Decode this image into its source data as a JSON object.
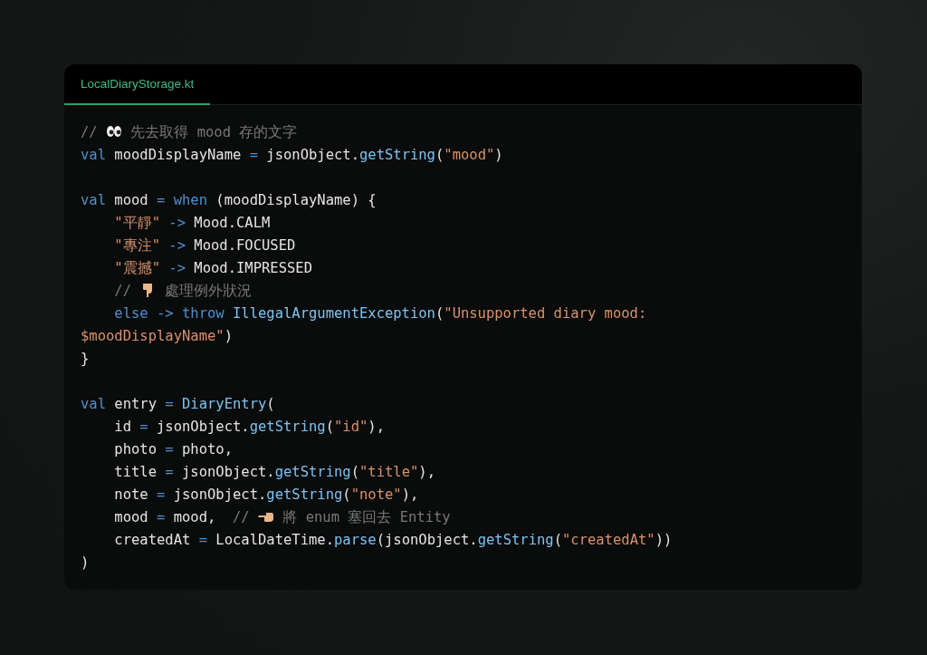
{
  "tab": {
    "label": "LocalDiaryStorage.kt",
    "selected": true
  },
  "lines": [
    {
      "kind": "code",
      "tokens": [
        {
          "kind": "comment",
          "t": "// "
        },
        {
          "kind": "eyes"
        },
        {
          "kind": "comment",
          "t": " 先去取得 mood 存的文字"
        }
      ]
    },
    {
      "kind": "code",
      "tokens": [
        {
          "kind": "keyword",
          "t": "val"
        },
        {
          "kind": "plain",
          "t": " moodDisplayName "
        },
        {
          "kind": "keyword",
          "t": "="
        },
        {
          "kind": "plain",
          "t": " jsonObject."
        },
        {
          "kind": "function",
          "t": "getString"
        },
        {
          "kind": "plain",
          "t": "("
        },
        {
          "kind": "string",
          "t": "\"mood\""
        },
        {
          "kind": "plain",
          "t": ")"
        }
      ]
    },
    {
      "kind": "blank"
    },
    {
      "kind": "code",
      "tokens": [
        {
          "kind": "keyword",
          "t": "val"
        },
        {
          "kind": "plain",
          "t": " mood "
        },
        {
          "kind": "keyword",
          "t": "="
        },
        {
          "kind": "keyword",
          "t": " when"
        },
        {
          "kind": "plain",
          "t": " (moodDisplayName) {"
        }
      ]
    },
    {
      "kind": "code",
      "tokens": [
        {
          "kind": "string",
          "t": "    \"平靜\""
        },
        {
          "kind": "keyword",
          "t": " ->"
        },
        {
          "kind": "plain",
          "t": " Mood.CALM"
        }
      ]
    },
    {
      "kind": "code",
      "tokens": [
        {
          "kind": "string",
          "t": "    \"專注\""
        },
        {
          "kind": "keyword",
          "t": " ->"
        },
        {
          "kind": "plain",
          "t": " Mood.FOCUSED"
        }
      ]
    },
    {
      "kind": "code",
      "tokens": [
        {
          "kind": "string",
          "t": "    \"震撼\""
        },
        {
          "kind": "keyword",
          "t": " ->"
        },
        {
          "kind": "plain",
          "t": " Mood.IMPRESSED"
        }
      ]
    },
    {
      "kind": "code",
      "tokens": [
        {
          "kind": "comment",
          "t": "    // "
        },
        {
          "kind": "hand-down"
        },
        {
          "kind": "comment",
          "t": " 處理例外狀況"
        }
      ]
    },
    {
      "kind": "code",
      "tokens": [
        {
          "kind": "keyword",
          "t": "    else ->"
        },
        {
          "kind": "keyword",
          "t": " throw"
        },
        {
          "kind": "function",
          "t": " IllegalArgumentException"
        },
        {
          "kind": "plain",
          "t": "("
        },
        {
          "kind": "string",
          "t": "\"Unsupported diary mood:"
        }
      ]
    },
    {
      "kind": "code",
      "tokens": [
        {
          "kind": "string",
          "t": "$moodDisplayName\""
        },
        {
          "kind": "plain",
          "t": ")"
        }
      ]
    },
    {
      "kind": "code",
      "tokens": [
        {
          "kind": "plain",
          "t": "}"
        }
      ]
    },
    {
      "kind": "blank"
    },
    {
      "kind": "code",
      "tokens": [
        {
          "kind": "keyword",
          "t": "val"
        },
        {
          "kind": "plain",
          "t": " entry "
        },
        {
          "kind": "keyword",
          "t": "="
        },
        {
          "kind": "function",
          "t": " DiaryEntry"
        },
        {
          "kind": "plain",
          "t": "("
        }
      ]
    },
    {
      "kind": "code",
      "tokens": [
        {
          "kind": "plain",
          "t": "    id "
        },
        {
          "kind": "keyword",
          "t": "="
        },
        {
          "kind": "plain",
          "t": " jsonObject."
        },
        {
          "kind": "function",
          "t": "getString"
        },
        {
          "kind": "plain",
          "t": "("
        },
        {
          "kind": "string",
          "t": "\"id\""
        },
        {
          "kind": "plain",
          "t": "),"
        }
      ]
    },
    {
      "kind": "code",
      "tokens": [
        {
          "kind": "plain",
          "t": "    photo "
        },
        {
          "kind": "keyword",
          "t": "="
        },
        {
          "kind": "plain",
          "t": " photo,"
        }
      ]
    },
    {
      "kind": "code",
      "tokens": [
        {
          "kind": "plain",
          "t": "    title "
        },
        {
          "kind": "keyword",
          "t": "="
        },
        {
          "kind": "plain",
          "t": " jsonObject."
        },
        {
          "kind": "function",
          "t": "getString"
        },
        {
          "kind": "plain",
          "t": "("
        },
        {
          "kind": "string",
          "t": "\"title\""
        },
        {
          "kind": "plain",
          "t": "),"
        }
      ]
    },
    {
      "kind": "code",
      "tokens": [
        {
          "kind": "plain",
          "t": "    note "
        },
        {
          "kind": "keyword",
          "t": "="
        },
        {
          "kind": "plain",
          "t": " jsonObject."
        },
        {
          "kind": "function",
          "t": "getString"
        },
        {
          "kind": "plain",
          "t": "("
        },
        {
          "kind": "string",
          "t": "\"note\""
        },
        {
          "kind": "plain",
          "t": "),"
        }
      ]
    },
    {
      "kind": "code",
      "tokens": [
        {
          "kind": "plain",
          "t": "    mood "
        },
        {
          "kind": "keyword",
          "t": "="
        },
        {
          "kind": "plain",
          "t": " mood,"
        },
        {
          "kind": "comment",
          "t": "  // "
        },
        {
          "kind": "hand-left"
        },
        {
          "kind": "comment",
          "t": " 將 enum 塞回去 Entity"
        }
      ]
    },
    {
      "kind": "code",
      "tokens": [
        {
          "kind": "plain",
          "t": "    createdAt "
        },
        {
          "kind": "keyword",
          "t": "="
        },
        {
          "kind": "plain",
          "t": " LocalDateTime."
        },
        {
          "kind": "function",
          "t": "parse"
        },
        {
          "kind": "plain",
          "t": "(jsonObject."
        },
        {
          "kind": "function",
          "t": "getString"
        },
        {
          "kind": "plain",
          "t": "("
        },
        {
          "kind": "string",
          "t": "\"createdAt\""
        },
        {
          "kind": "plain",
          "t": "))"
        }
      ]
    },
    {
      "kind": "code",
      "tokens": [
        {
          "kind": "plain",
          "t": ")"
        }
      ]
    }
  ]
}
